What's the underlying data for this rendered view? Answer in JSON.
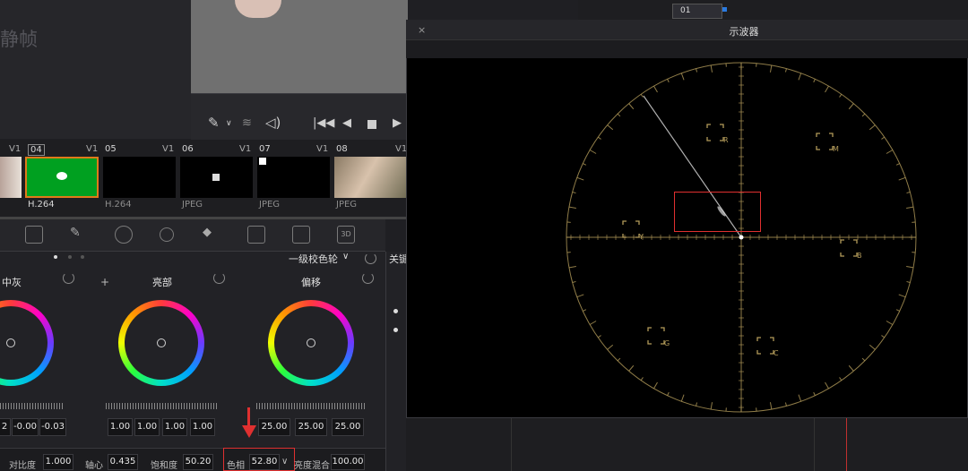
{
  "viewer": {
    "still_label": "静帧"
  },
  "clips": [
    {
      "num": "04",
      "track": "V1",
      "codec": "H.264"
    },
    {
      "num": "05",
      "track": "V1",
      "codec": "H.264"
    },
    {
      "num": "06",
      "track": "V1",
      "codec": "JPEG"
    },
    {
      "num": "07",
      "track": "V1",
      "codec": "JPEG"
    },
    {
      "num": "08",
      "track": "V1",
      "codec": "JPEG"
    }
  ],
  "clip_prev_track": "V1",
  "wheels": {
    "mode": "一级校色轮",
    "gamma": {
      "title": "中灰",
      "values": [
        "2",
        "-0.00",
        "-0.03"
      ]
    },
    "gain": {
      "title": "亮部",
      "values": [
        "1.00",
        "1.00",
        "1.00",
        "1.00"
      ]
    },
    "offset": {
      "title": "偏移",
      "values": [
        "25.00",
        "25.00",
        "25.00"
      ]
    }
  },
  "adjust": {
    "contrast_label": "对比度",
    "contrast": "1.000",
    "pivot_label": "轴心",
    "pivot": "0.435",
    "sat_label": "饱和度",
    "sat": "50.20",
    "hue_label": "色相",
    "hue": "52.80",
    "lummix_label": "亮度混合",
    "lummix": "100.00"
  },
  "side_tab": "关键",
  "scope": {
    "title": "示波器",
    "targets": [
      "R",
      "M",
      "B",
      "C",
      "G",
      "Y"
    ]
  },
  "node": {
    "label": "01"
  },
  "colors": {
    "accent": "#e03030",
    "scope_grat": "#b39b5a",
    "clip_select": "#e07a1a"
  }
}
